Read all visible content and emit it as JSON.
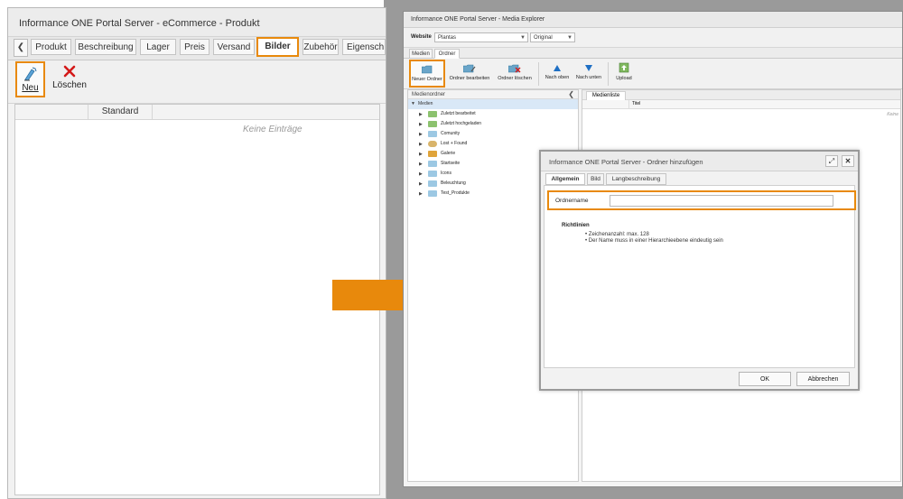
{
  "left_window": {
    "title": "Informance ONE Portal Server - eCommerce - Produkt",
    "tabs": [
      "Produkt",
      "Beschreibung",
      "Lager",
      "Preis",
      "Versand",
      "Bilder",
      "Zubehör",
      "Eigensch"
    ],
    "active_tab": "Bilder",
    "toolbar": {
      "new_label": "Neu",
      "delete_label": "Löschen"
    },
    "grid": {
      "column": "Standard",
      "empty_text": "Keine Einträge"
    }
  },
  "media_explorer": {
    "title": "Informance ONE Portal Server - Media Explorer",
    "website_label": "Website",
    "website_value": "Plantas",
    "version_value": "Original",
    "subtabs": [
      "Medien",
      "Ordner"
    ],
    "active_subtab": "Ordner",
    "toolbar": {
      "new_folder": "Neuer Ordner",
      "edit_folder": "Ordner bearbeiten",
      "delete_folder": "Ordner löschen",
      "move_up": "Nach oben",
      "move_down": "Nach unten",
      "upload": "Upload"
    },
    "left_pane_title": "Medienordner",
    "tree_root": "Medien",
    "tree_items": [
      "Zuletzt bearbeitet",
      "Zuletzt hochgeladen",
      "Comunity",
      "Lost + Found",
      "Galerie",
      "Startseite",
      "Icons",
      "Beleuchtung",
      "Test_Produkte"
    ],
    "right_pane_tab": "Medienliste",
    "right_pane_column": "Titel",
    "right_pane_empty": "Keine"
  },
  "dialog": {
    "title": "Informance ONE Portal Server - Ordner hinzufügen",
    "tabs": [
      "Allgemein",
      "Bild",
      "Langbeschreibung"
    ],
    "active_tab": "Allgemein",
    "field_label": "Ordnername",
    "field_value": "",
    "guidelines_title": "Richtlinien",
    "guidelines": [
      "Zeichenanzahl: max. 128",
      "Der Name muss in einer Hierarchieebene eindeutig sein"
    ],
    "ok_label": "OK",
    "cancel_label": "Abbrechen"
  },
  "colors": {
    "highlight": "#e8890c",
    "arrow": "#e8890c"
  }
}
